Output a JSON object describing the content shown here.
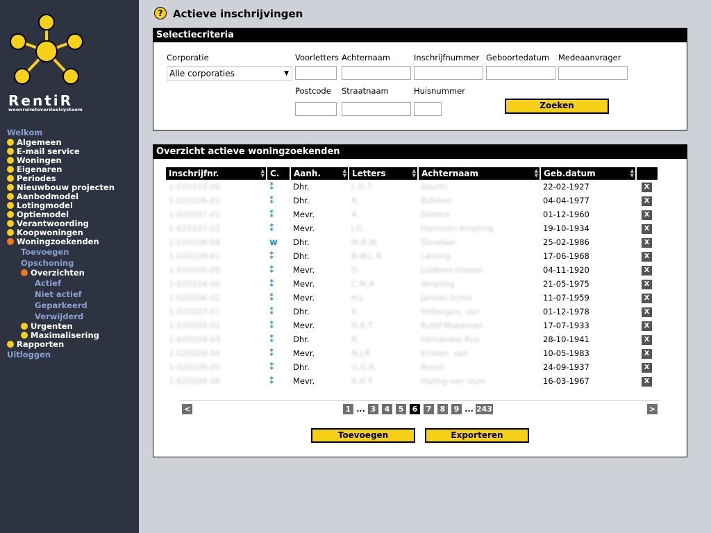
{
  "brand": {
    "name": "RentiR",
    "tagline": "woonruimteverdeelsysteem"
  },
  "sidebar": {
    "top_link": "Welkom",
    "items": [
      "Algemeen",
      "E-mail service",
      "Woningen",
      "Eigenaren",
      "Periodes",
      "Nieuwbouw projecten",
      "Aanbodmodel",
      "Lotingmodel",
      "Optiemodel",
      "Verantwoording",
      "Koopwoningen"
    ],
    "active": "Woningzoekenden",
    "sub": [
      "Toevoegen",
      "Opschoning"
    ],
    "sub_active": "Overzichten",
    "sub_sub": [
      "Actief",
      "Niet actief",
      "Geparkeerd",
      "Verwijderd"
    ],
    "after": [
      "Urgenten",
      "Maximalisering"
    ],
    "bottom_item": "Rapporten",
    "logout": "Uitloggen"
  },
  "page": {
    "title": "Actieve inschrijvingen",
    "help_icon": "?"
  },
  "criteria": {
    "header": "Selectiecriteria",
    "labels": {
      "corporatie": "Corporatie",
      "voorletters": "Voorletters",
      "achternaam": "Achternaam",
      "inschrijfnummer": "Inschrijfnummer",
      "geboortedatum": "Geboortedatum",
      "medeaanvrager": "Medeaanvrager",
      "postcode": "Postcode",
      "straatnaam": "Straatnaam",
      "huisnummer": "Huisnummer"
    },
    "corporatie_value": "Alle corporaties",
    "search_button": "Zoeken"
  },
  "overview": {
    "header": "Overzicht actieve woningzoekenden",
    "columns": [
      "Inschrijfnr.",
      "C.",
      "Aanh.",
      "Letters",
      "Achternaam",
      "Geb.datum"
    ],
    "rows": [
      {
        "nr": "1-020103-00",
        "c": "wave",
        "aanh": "Dhr.",
        "letters": "L.G.T.",
        "naam": "Geurts",
        "geb": "22-02-1927"
      },
      {
        "nr": "1-020106-03",
        "c": "wave",
        "aanh": "Dhr.",
        "letters": "R.",
        "naam": "Bohmer",
        "geb": "04-04-1977"
      },
      {
        "nr": "1-020107-01",
        "c": "wave",
        "aanh": "Mevr.",
        "letters": "A.",
        "naam": "Dolstra",
        "geb": "01-12-1960"
      },
      {
        "nr": "1-020107-02",
        "c": "wave",
        "aanh": "Mevr.",
        "letters": "J.G.",
        "naam": "Harmsen-Ampting",
        "geb": "19-10-1934"
      },
      {
        "nr": "1-020108-04",
        "c": "w",
        "aanh": "Dhr.",
        "letters": "M.B.W.",
        "naam": "Davelaar",
        "geb": "25-02-1986"
      },
      {
        "nr": "1-020109-01",
        "c": "wave",
        "aanh": "Dhr.",
        "letters": "B.W.L.R.",
        "naam": "Lanting",
        "geb": "17-06-1968"
      },
      {
        "nr": "1-020200-00",
        "c": "wave",
        "aanh": "Mevr.",
        "letters": "D.",
        "naam": "Lubbers-Giesen",
        "geb": "04-11-1920"
      },
      {
        "nr": "1-020204-00",
        "c": "wave",
        "aanh": "Mevr.",
        "letters": "C.M.A.",
        "naam": "Ampting",
        "geb": "21-05-1975"
      },
      {
        "nr": "1-020206-02",
        "c": "wave",
        "aanh": "Mevr.",
        "letters": "H.J.",
        "naam": "Jansen-Schol",
        "geb": "11-07-1959"
      },
      {
        "nr": "1-020207-01",
        "c": "wave",
        "aanh": "Dhr.",
        "letters": "R.",
        "naam": "Willengen, van",
        "geb": "01-12-1978"
      },
      {
        "nr": "1-020209-01",
        "c": "wave",
        "aanh": "Mevr.",
        "letters": "H.A.T.",
        "naam": "Rubtf-Makeman",
        "geb": "17-07-1933"
      },
      {
        "nr": "1-020209-03",
        "c": "wave",
        "aanh": "Dhr.",
        "letters": "R.",
        "naam": "Fernandez Rue",
        "geb": "28-10-1941"
      },
      {
        "nr": "1-020209-04",
        "c": "wave",
        "aanh": "Mevr.",
        "letters": "N.J.R.",
        "naam": "Einden, van",
        "geb": "10-05-1983"
      },
      {
        "nr": "1-020209-05",
        "c": "wave",
        "aanh": "Dhr.",
        "letters": "G.G.A.",
        "naam": "Bosch",
        "geb": "24-09-1937"
      },
      {
        "nr": "1-020209-06",
        "c": "wave",
        "aanh": "Mevr.",
        "letters": "A.H.T.",
        "naam": "Huting-van Uum",
        "geb": "16-03-1967"
      }
    ],
    "delete_label": "X",
    "pager": {
      "prev": "<",
      "next": ">",
      "pages": [
        "1",
        "3",
        "4",
        "5",
        "6",
        "7",
        "8",
        "9",
        "243"
      ],
      "current": "6",
      "ellipsis": "..."
    },
    "add_button": "Toevoegen",
    "export_button": "Exporteren"
  }
}
